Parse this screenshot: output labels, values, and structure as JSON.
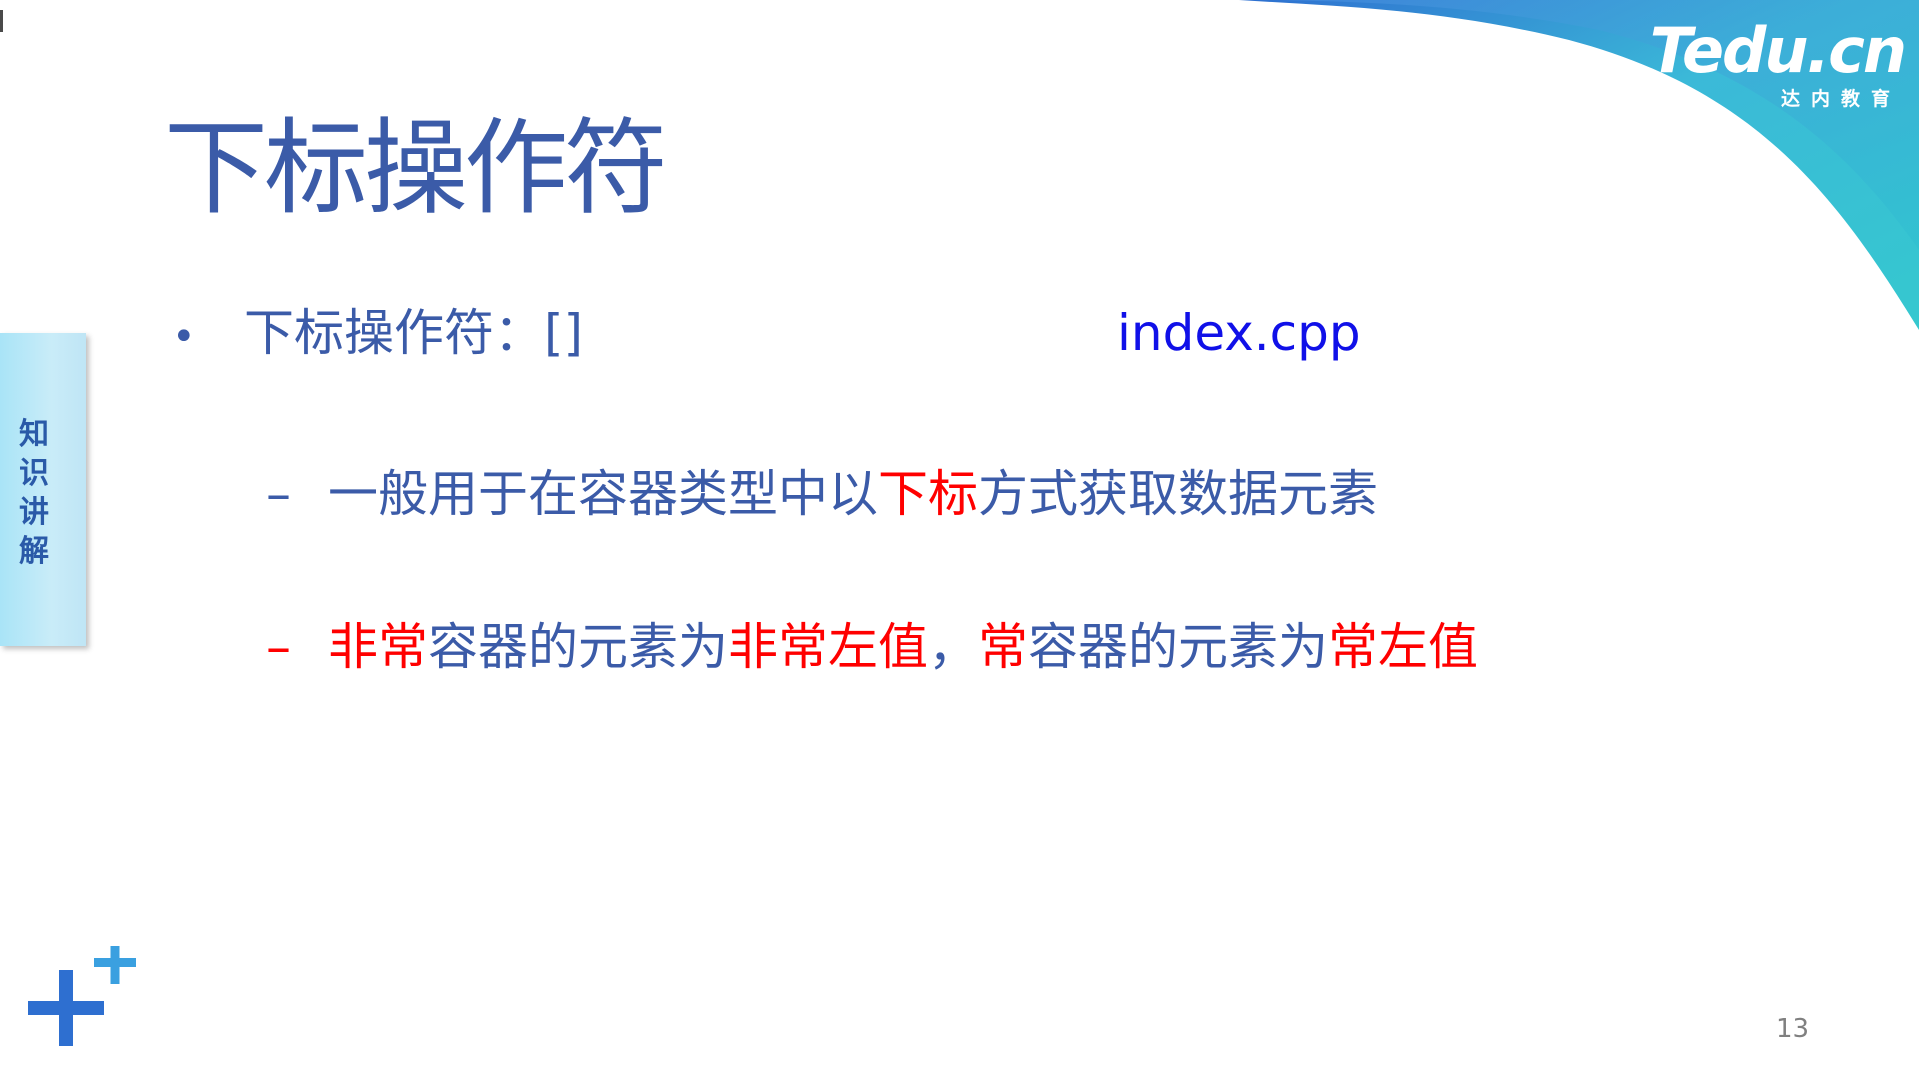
{
  "logo": {
    "main": "Tedu.cn",
    "sub": "达内教育"
  },
  "title": "下标操作符",
  "side_tab": {
    "label": "知\n识\n讲\n解"
  },
  "bullet": {
    "marker": "•",
    "text": "下标操作符：[]"
  },
  "filename": "index.cpp",
  "sub_bullets": [
    {
      "marker": "–",
      "segments": [
        {
          "text": "一般用于在容器类型中以",
          "color": "blue"
        },
        {
          "text": "下标",
          "color": "red"
        },
        {
          "text": "方式获取数据元素",
          "color": "blue"
        }
      ]
    },
    {
      "marker": "–",
      "segments": [
        {
          "text": "非常",
          "color": "red"
        },
        {
          "text": "容器的元素为",
          "color": "blue"
        },
        {
          "text": "非常左值",
          "color": "red"
        },
        {
          "text": "，",
          "color": "blue"
        },
        {
          "text": "常",
          "color": "red"
        },
        {
          "text": "容器的元素为",
          "color": "blue"
        },
        {
          "text": "常左值",
          "color": "red"
        }
      ]
    }
  ],
  "page_number": "13",
  "colors": {
    "title_blue": "#3b5ba8",
    "highlight_red": "#ff0000",
    "filename_blue": "#1010e8",
    "logo_teal": "#2ec5cf",
    "logo_blue": "#3a7bd5"
  },
  "icons": {
    "plus_decoration": "plus-icon"
  }
}
